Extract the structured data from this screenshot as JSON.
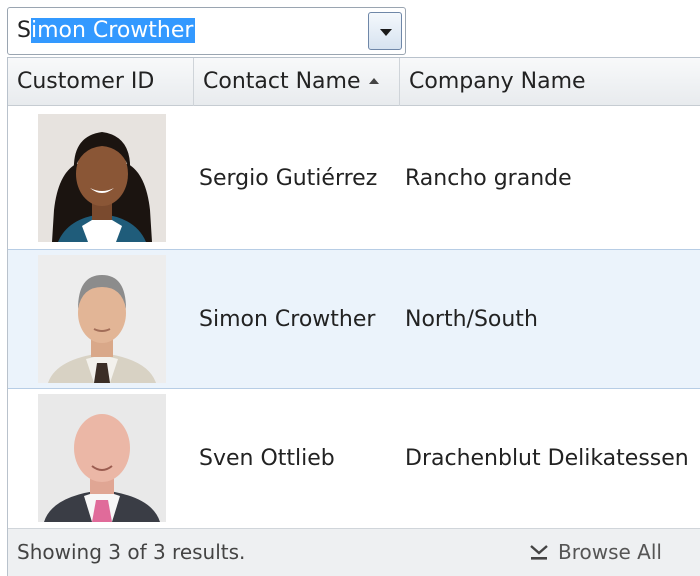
{
  "combo": {
    "typed_text": "S",
    "selected_text": "imon Crowther"
  },
  "grid": {
    "columns": [
      {
        "label": "Customer ID"
      },
      {
        "label": "Contact Name",
        "sort": "ascending"
      },
      {
        "label": "Company Name"
      }
    ],
    "rows": [
      {
        "contact_name": "Sergio Gutiérrez",
        "company_name": "Rancho grande",
        "photo": "man-curly-hair-photo"
      },
      {
        "contact_name": "Simon Crowther",
        "company_name": "North/South",
        "photo": "man-gray-hair-tie-photo",
        "selected": true
      },
      {
        "contact_name": "Sven Ottlieb",
        "company_name": "Drachenblut Delikatessen",
        "photo": "bald-man-pink-tie-photo"
      }
    ]
  },
  "footer": {
    "status": "Showing 3 of 3 results.",
    "browse_label": "Browse All"
  },
  "colors": {
    "selection": "#3399ff",
    "selected_row": "#ebf3fb",
    "header_bg": "#eceff1"
  }
}
